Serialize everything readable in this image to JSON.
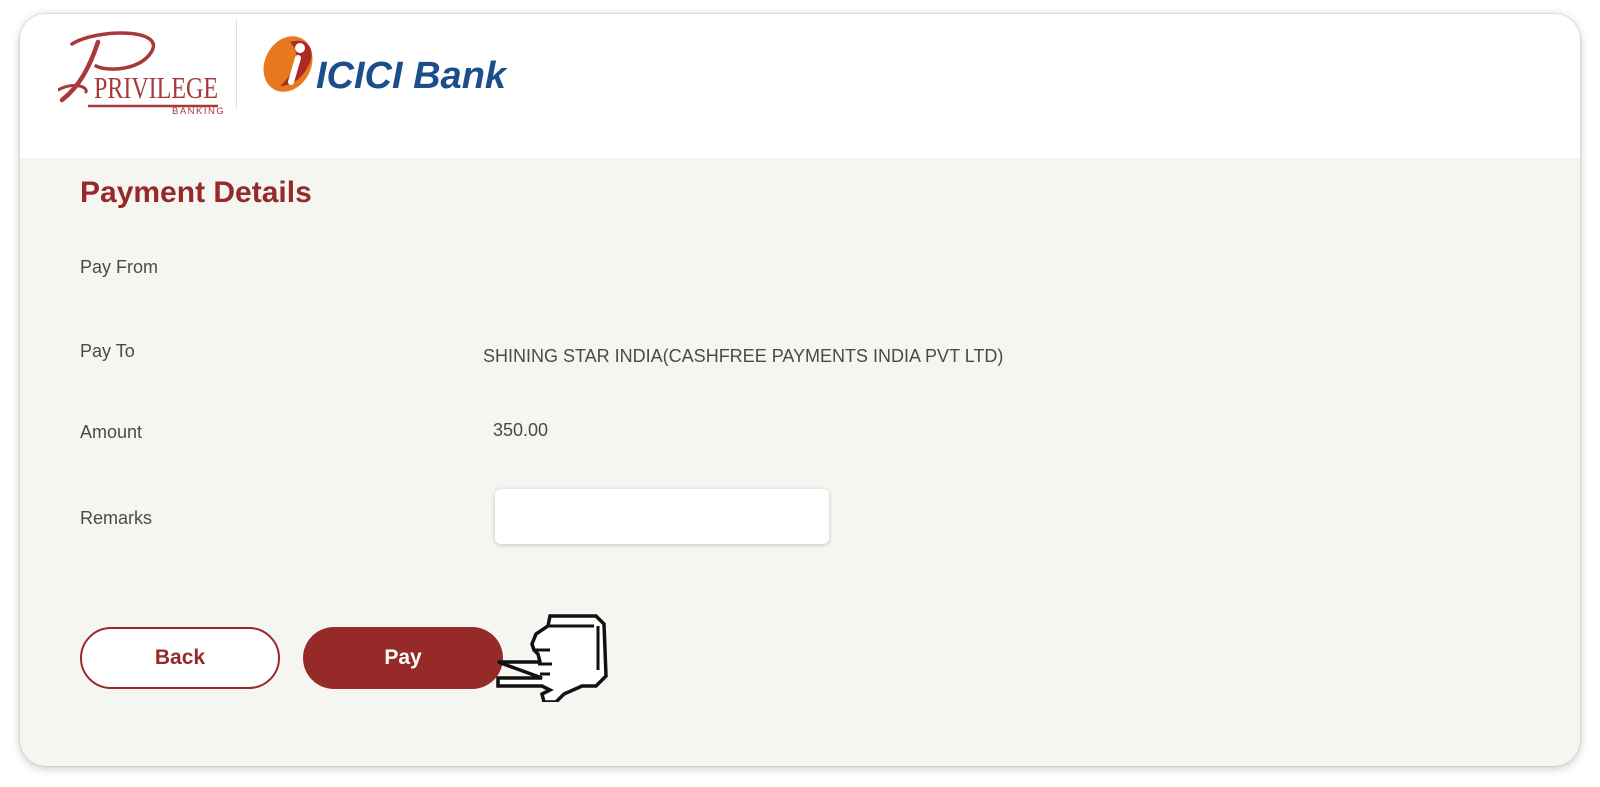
{
  "brand": {
    "privilege_logo_text": "PRIVILEGE",
    "privilege_logo_subtext": "BANKING",
    "bank_name": "ICICI Bank",
    "primary_color": "#952a28",
    "icici_blue": "#1d4e8c",
    "icici_orange": "#e8781e"
  },
  "payment": {
    "title": "Payment Details",
    "pay_from_label": "Pay From",
    "pay_from_value": "",
    "pay_to_label": "Pay To",
    "pay_to_value": "SHINING STAR INDIA(CASHFREE PAYMENTS INDIA PVT LTD)",
    "amount_label": "Amount",
    "amount_value": "350.00",
    "remarks_label": "Remarks",
    "remarks_value": "",
    "remarks_placeholder": ""
  },
  "actions": {
    "back_label": "Back",
    "pay_label": "Pay"
  },
  "cursor": {
    "icon": "hand-pointer-icon"
  }
}
